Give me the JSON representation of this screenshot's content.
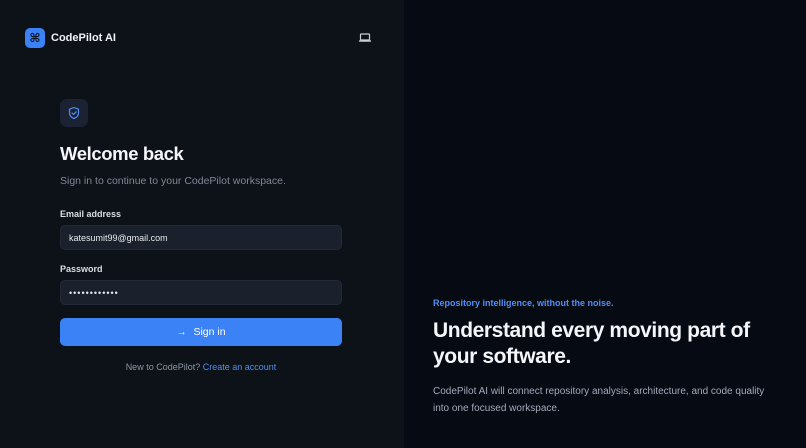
{
  "brand": {
    "logo_glyph": "⌘",
    "name": "CodePilot AI"
  },
  "theme_toggle": {
    "icon": "laptop-icon"
  },
  "login": {
    "icon": "shield-check-icon",
    "heading": "Welcome back",
    "subheading": "Sign in to continue to your CodePilot workspace.",
    "email_label": "Email address",
    "email_value": "katesumit99@gmail.com",
    "password_label": "Password",
    "password_value": "••••••••••••",
    "signin_label": "Sign in",
    "footer_text": "New to CodePilot?",
    "footer_link": "Create an account"
  },
  "marketing": {
    "eyebrow": "Repository intelligence, without the noise.",
    "headline": "Understand every moving part of your software.",
    "description": "CodePilot AI will connect repository analysis, architecture, and code quality into one focused workspace."
  },
  "colors": {
    "accent": "#3b82f6",
    "link": "#4f8ff7",
    "left_bg": "#0d1118",
    "right_bg": "#060a13",
    "input_bg": "#1b212c"
  }
}
